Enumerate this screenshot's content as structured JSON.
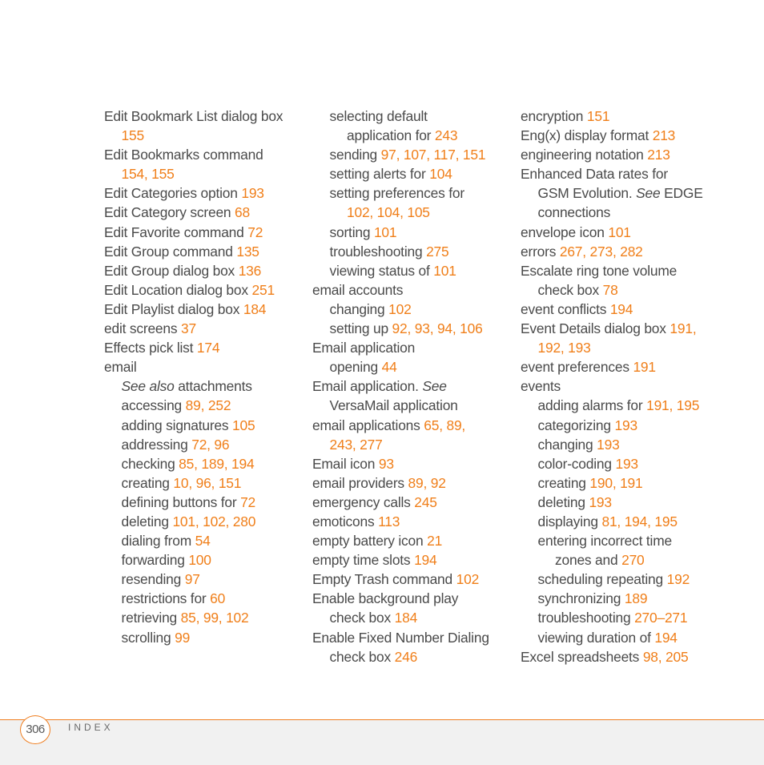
{
  "colors": {
    "text": "#4a4a4a",
    "page_ref": "#f07f1a",
    "rule": "#ef7d1e",
    "footer_bg": "#f1f1f1"
  },
  "columns": [
    [
      {
        "level": 0,
        "text": "Edit Bookmark List dialog box",
        "refs": ""
      },
      {
        "level": 1,
        "text": "",
        "refs": "155"
      },
      {
        "level": 0,
        "text": "Edit Bookmarks command",
        "refs": ""
      },
      {
        "level": 1,
        "text": "",
        "refs": "154, 155"
      },
      {
        "level": 0,
        "text": "Edit Categories option ",
        "refs": "193"
      },
      {
        "level": 0,
        "text": "Edit Category screen ",
        "refs": "68"
      },
      {
        "level": 0,
        "text": "Edit Favorite command ",
        "refs": "72"
      },
      {
        "level": 0,
        "text": "Edit Group command ",
        "refs": "135"
      },
      {
        "level": 0,
        "text": "Edit Group dialog box ",
        "refs": "136"
      },
      {
        "level": 0,
        "text": "Edit Location dialog box ",
        "refs": "251"
      },
      {
        "level": 0,
        "text": "Edit Playlist dialog box ",
        "refs": "184"
      },
      {
        "level": 0,
        "text": "edit screens ",
        "refs": "37"
      },
      {
        "level": 0,
        "text": "Effects pick list ",
        "refs": "174"
      },
      {
        "level": 0,
        "text": "email",
        "refs": ""
      },
      {
        "level": 1,
        "italic": "See also",
        "text": " attachments",
        "refs": ""
      },
      {
        "level": 1,
        "text": "accessing ",
        "refs": "89, 252"
      },
      {
        "level": 1,
        "text": "adding signatures ",
        "refs": "105"
      },
      {
        "level": 1,
        "text": "addressing ",
        "refs": "72, 96"
      },
      {
        "level": 1,
        "text": "checking ",
        "refs": "85, 189, 194"
      },
      {
        "level": 1,
        "text": "creating ",
        "refs": "10, 96, 151"
      },
      {
        "level": 1,
        "text": "defining buttons for ",
        "refs": "72"
      },
      {
        "level": 1,
        "text": "deleting ",
        "refs": "101, 102, 280"
      },
      {
        "level": 1,
        "text": "dialing from ",
        "refs": "54"
      },
      {
        "level": 1,
        "text": "forwarding ",
        "refs": "100"
      },
      {
        "level": 1,
        "text": "resending ",
        "refs": "97"
      },
      {
        "level": 1,
        "text": "restrictions for ",
        "refs": "60"
      },
      {
        "level": 1,
        "text": "retrieving ",
        "refs": "85, 99, 102"
      },
      {
        "level": 1,
        "text": "scrolling ",
        "refs": "99"
      }
    ],
    [
      {
        "level": 1,
        "text": "selecting default",
        "refs": ""
      },
      {
        "level": 2,
        "text": "application for ",
        "refs": "243"
      },
      {
        "level": 1,
        "text": "sending ",
        "refs": "97, 107, 117, 151"
      },
      {
        "level": 1,
        "text": "setting alerts for ",
        "refs": "104"
      },
      {
        "level": 1,
        "text": "setting preferences for",
        "refs": ""
      },
      {
        "level": 2,
        "text": "",
        "refs": "102, 104, 105"
      },
      {
        "level": 1,
        "text": "sorting ",
        "refs": "101"
      },
      {
        "level": 1,
        "text": "troubleshooting ",
        "refs": "275"
      },
      {
        "level": 1,
        "text": "viewing status of ",
        "refs": "101"
      },
      {
        "level": 0,
        "text": "email accounts",
        "refs": ""
      },
      {
        "level": 1,
        "text": "changing ",
        "refs": "102"
      },
      {
        "level": 1,
        "text": "setting up ",
        "refs": "92, 93, 94, 106"
      },
      {
        "level": 0,
        "text": "Email application",
        "refs": ""
      },
      {
        "level": 1,
        "text": "opening ",
        "refs": "44"
      },
      {
        "level": 0,
        "text": "Email application. ",
        "italic_after": "See",
        "refs": ""
      },
      {
        "level": 1,
        "text": "VersaMail application",
        "refs": ""
      },
      {
        "level": 0,
        "text": "email applications ",
        "refs": "65, 89,"
      },
      {
        "level": 1,
        "text": "",
        "refs": "243, 277"
      },
      {
        "level": 0,
        "text": "Email icon ",
        "refs": "93"
      },
      {
        "level": 0,
        "text": "email providers ",
        "refs": "89, 92"
      },
      {
        "level": 0,
        "text": "emergency calls ",
        "refs": "245"
      },
      {
        "level": 0,
        "text": "emoticons ",
        "refs": "113"
      },
      {
        "level": 0,
        "text": "empty battery icon ",
        "refs": "21"
      },
      {
        "level": 0,
        "text": "empty time slots ",
        "refs": "194"
      },
      {
        "level": 0,
        "text": "Empty Trash command ",
        "refs": "102"
      },
      {
        "level": 0,
        "text": "Enable background play",
        "refs": ""
      },
      {
        "level": 1,
        "text": "check box ",
        "refs": "184"
      },
      {
        "level": 0,
        "text": "Enable Fixed Number Dialing",
        "refs": ""
      },
      {
        "level": 1,
        "text": "check box ",
        "refs": "246"
      }
    ],
    [
      {
        "level": 0,
        "text": "encryption ",
        "refs": "151"
      },
      {
        "level": 0,
        "text": "Eng(x) display format ",
        "refs": "213"
      },
      {
        "level": 0,
        "text": "engineering notation ",
        "refs": "213"
      },
      {
        "level": 0,
        "text": "Enhanced Data rates for",
        "refs": ""
      },
      {
        "level": 1,
        "text": "GSM Evolution. ",
        "italic_after": "See",
        "text_after": " EDGE",
        "refs": ""
      },
      {
        "level": 1,
        "text": "connections",
        "refs": ""
      },
      {
        "level": 0,
        "text": "envelope icon ",
        "refs": "101"
      },
      {
        "level": 0,
        "text": "errors ",
        "refs": "267, 273, 282"
      },
      {
        "level": 0,
        "text": "Escalate ring tone volume",
        "refs": ""
      },
      {
        "level": 1,
        "text": "check box ",
        "refs": "78"
      },
      {
        "level": 0,
        "text": "event conflicts ",
        "refs": "194"
      },
      {
        "level": 0,
        "text": "Event Details dialog box ",
        "refs": "191,"
      },
      {
        "level": 1,
        "text": "",
        "refs": "192, 193"
      },
      {
        "level": 0,
        "text": "event preferences ",
        "refs": "191"
      },
      {
        "level": 0,
        "text": "events",
        "refs": ""
      },
      {
        "level": 1,
        "text": "adding alarms for ",
        "refs": "191, 195"
      },
      {
        "level": 1,
        "text": "categorizing ",
        "refs": "193"
      },
      {
        "level": 1,
        "text": "changing ",
        "refs": "193"
      },
      {
        "level": 1,
        "text": "color-coding ",
        "refs": "193"
      },
      {
        "level": 1,
        "text": "creating ",
        "refs": "190, 191"
      },
      {
        "level": 1,
        "text": "deleting ",
        "refs": "193"
      },
      {
        "level": 1,
        "text": "displaying ",
        "refs": "81, 194, 195"
      },
      {
        "level": 1,
        "text": "entering incorrect time",
        "refs": ""
      },
      {
        "level": 2,
        "text": "zones and ",
        "refs": "270"
      },
      {
        "level": 1,
        "text": "scheduling repeating ",
        "refs": "192"
      },
      {
        "level": 1,
        "text": "synchronizing ",
        "refs": "189"
      },
      {
        "level": 1,
        "text": "troubleshooting ",
        "refs": "270–271"
      },
      {
        "level": 1,
        "text": "viewing duration of ",
        "refs": "194"
      },
      {
        "level": 0,
        "text": "Excel spreadsheets ",
        "refs": "98, 205"
      }
    ]
  ],
  "footer": {
    "page_number": "306",
    "section_label": "INDEX"
  }
}
